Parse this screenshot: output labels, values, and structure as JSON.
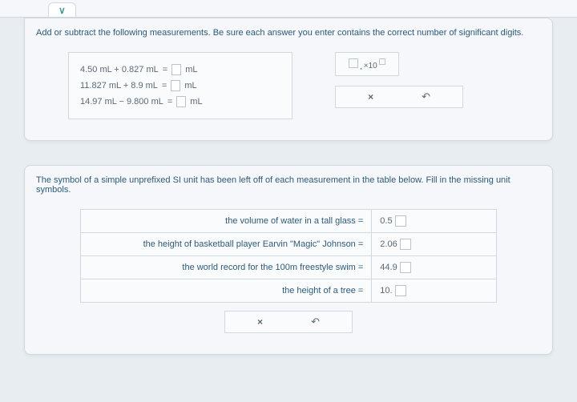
{
  "q1": {
    "prompt": "Add or subtract the following measurements. Be sure each answer you enter contains the correct number of significant digits.",
    "rows": [
      {
        "expr": "4.50 mL + 0.827 mL",
        "eq": "=",
        "unit": "mL"
      },
      {
        "expr": "11.827 mL + 8.9 mL",
        "eq": "=",
        "unit": "mL"
      },
      {
        "expr": "14.97 mL − 9.800 mL",
        "eq": "=",
        "unit": "mL"
      }
    ],
    "sci_times": "×10"
  },
  "q2": {
    "prompt": "The symbol of a simple unprefixed SI unit has been left off of each measurement in the table below. Fill in the missing unit symbols.",
    "rows": [
      {
        "label": "the volume of water in a tall glass =",
        "value": "0.5"
      },
      {
        "label": "the height of basketball player Earvin \"Magic\" Johnson =",
        "value": "2.06"
      },
      {
        "label": "the world record for the 100m freestyle swim =",
        "value": "44.9"
      },
      {
        "label": "the height of a tree =",
        "value": "10."
      }
    ]
  }
}
